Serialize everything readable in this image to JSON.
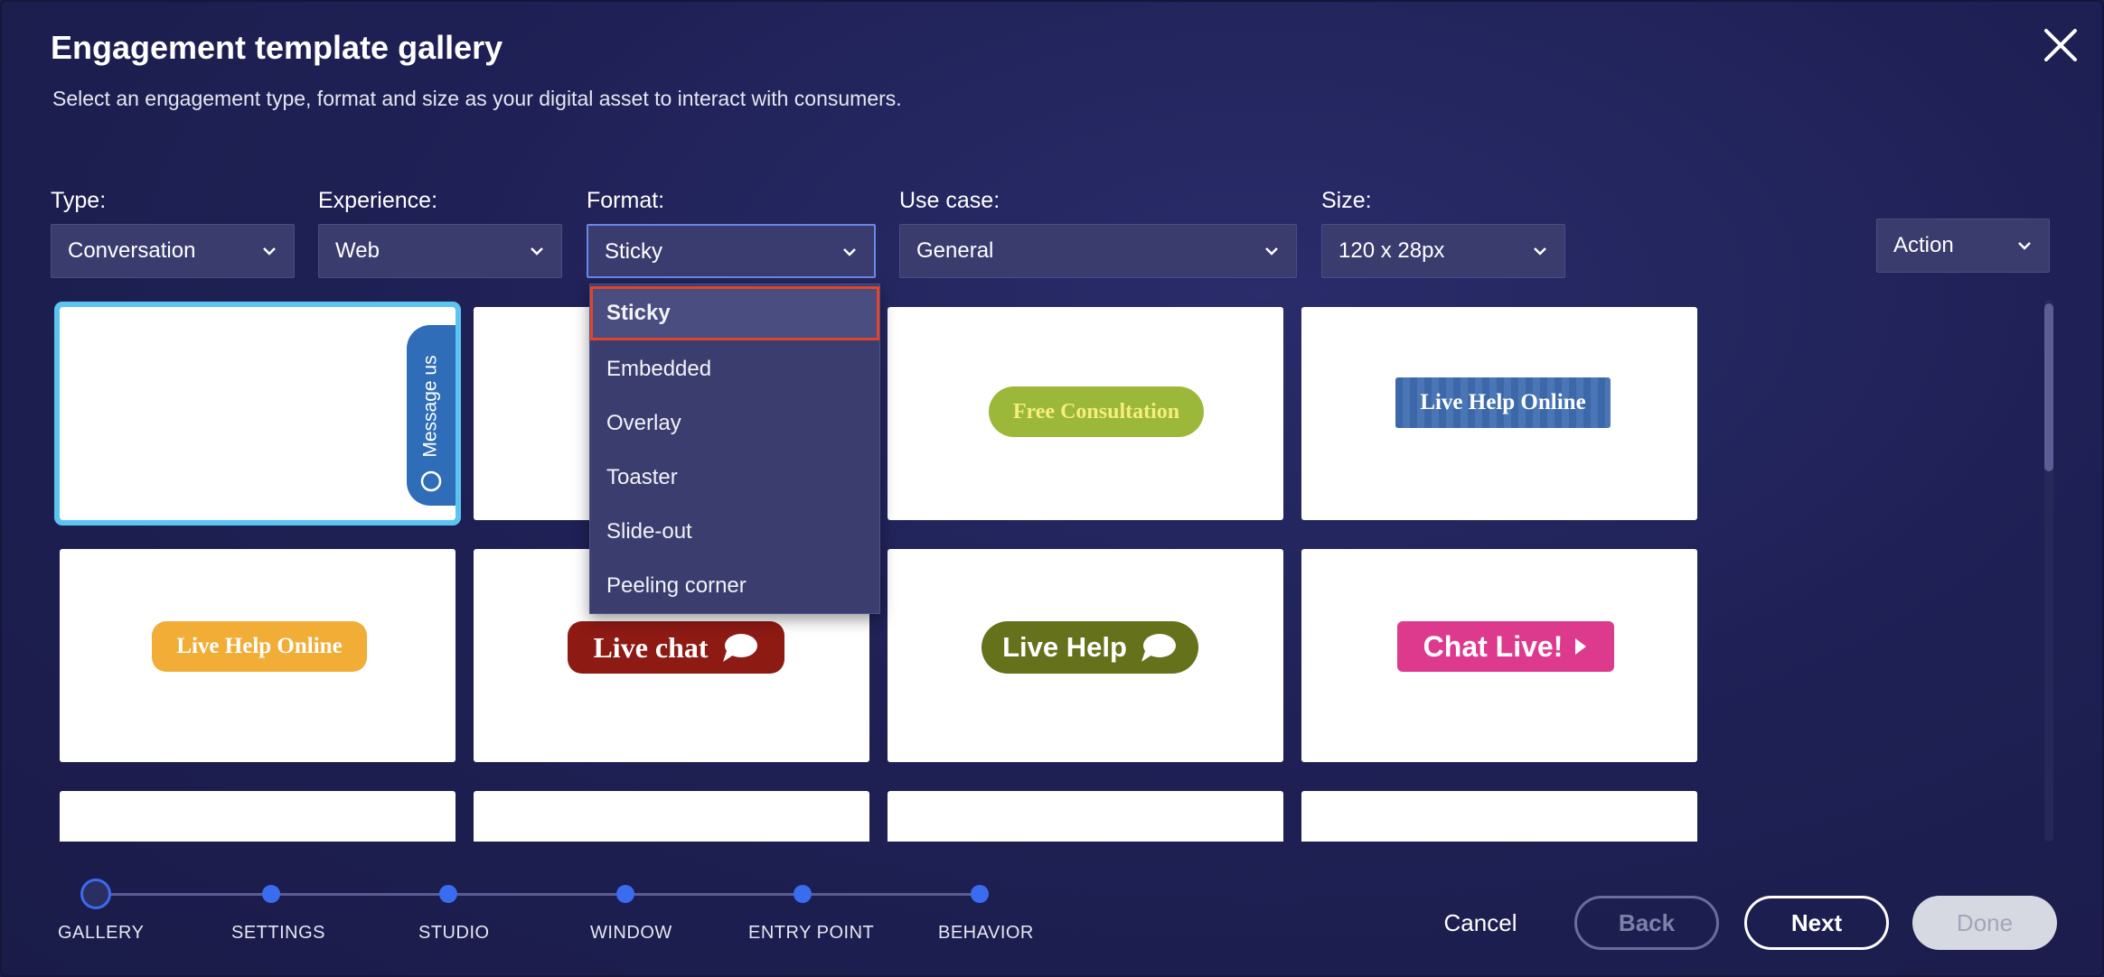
{
  "header": {
    "title": "Engagement template gallery",
    "subtitle": "Select an engagement type, format and size as your digital asset to interact with consumers."
  },
  "filters": {
    "type": {
      "label": "Type:",
      "value": "Conversation"
    },
    "experience": {
      "label": "Experience:",
      "value": "Web"
    },
    "format": {
      "label": "Format:",
      "value": "Sticky"
    },
    "use_case": {
      "label": "Use case:",
      "value": "General"
    },
    "size": {
      "label": "Size:",
      "value": "120 x 28px"
    },
    "action": {
      "value": "Action"
    }
  },
  "format_options": [
    "Sticky",
    "Embedded",
    "Overlay",
    "Toaster",
    "Slide-out",
    "Peeling corner"
  ],
  "templates": [
    {
      "text": "Message us",
      "color": "#2f6db8"
    },
    {
      "text": "",
      "color": ""
    },
    {
      "text": "Free Consultation",
      "color": "#9bb83a"
    },
    {
      "text": "Live Help Online",
      "color": "#3c67a8"
    },
    {
      "text": "Live Help Online",
      "color": "#f1ad36"
    },
    {
      "text": "Live chat",
      "color": "#8e1a14"
    },
    {
      "text": "Live Help",
      "color": "#66711b"
    },
    {
      "text": "Chat Live!",
      "color": "#dd3a8e"
    }
  ],
  "steps": [
    "GALLERY",
    "SETTINGS",
    "STUDIO",
    "WINDOW",
    "ENTRY POINT",
    "BEHAVIOR"
  ],
  "footer": {
    "cancel": "Cancel",
    "back": "Back",
    "next": "Next",
    "done": "Done"
  },
  "colors": {
    "accent": "#3a6cf0",
    "selection_outline": "#5cc4f1",
    "dropdown_highlight": "#e0442a"
  }
}
